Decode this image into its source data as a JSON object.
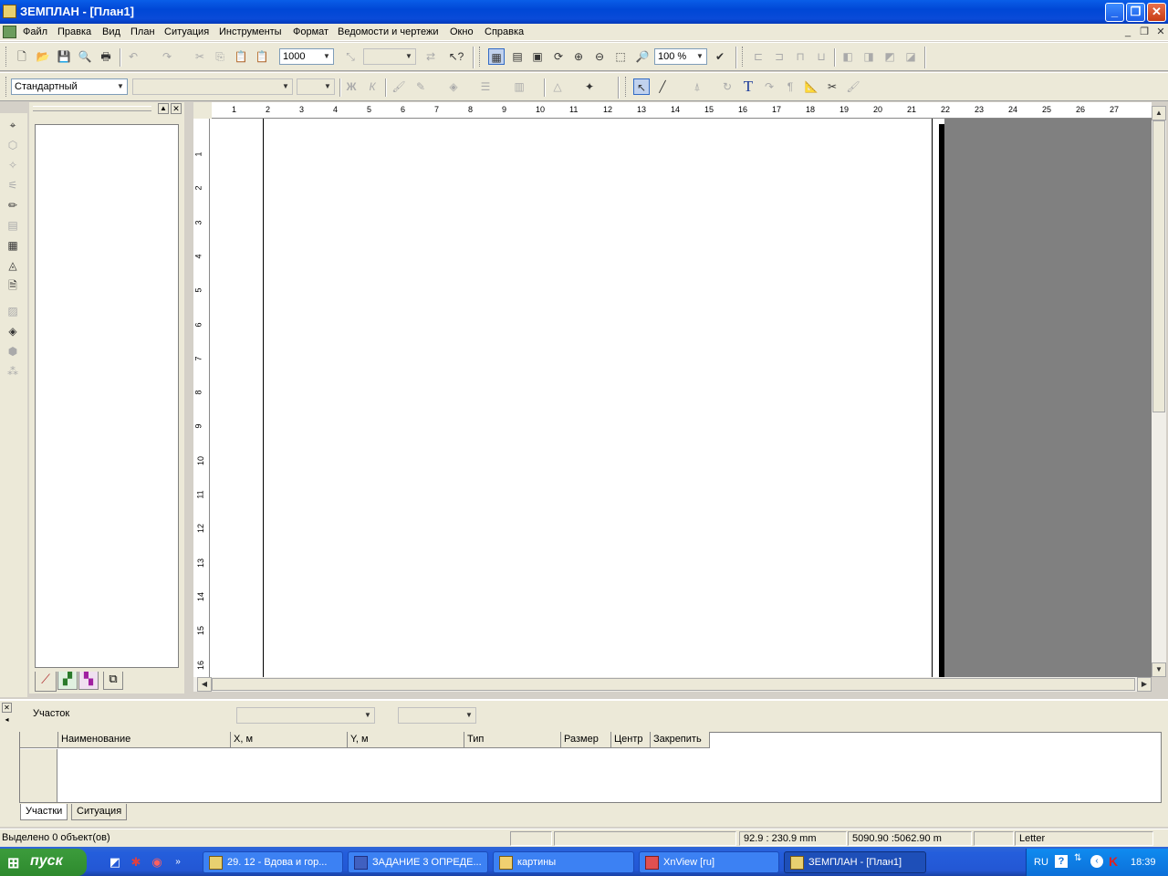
{
  "window": {
    "title": "ЗЕМПЛАН - [План1]"
  },
  "menu": [
    "Файл",
    "Правка",
    "Вид",
    "План",
    "Ситуация",
    "Инструменты",
    "Формат",
    "Ведомости и чертежи",
    "Окно",
    "Справка"
  ],
  "toolbar1": {
    "scale_value": "1000",
    "zoom_value": "100 %"
  },
  "toolbar2": {
    "style_value": "Стандартный",
    "bold_label": "Ж",
    "italic_label": "К",
    "text_tool": "T"
  },
  "ruler_top": [
    "1",
    "2",
    "3",
    "4",
    "5",
    "6",
    "7",
    "8",
    "9",
    "10",
    "11",
    "12",
    "13",
    "14",
    "15",
    "16",
    "17",
    "18",
    "19",
    "20",
    "21",
    "22",
    "23",
    "24",
    "25",
    "26",
    "27"
  ],
  "ruler_left": [
    "1",
    "2",
    "3",
    "4",
    "5",
    "6",
    "7",
    "8",
    "9",
    "10",
    "11",
    "12",
    "13",
    "14",
    "15",
    "16"
  ],
  "bottom_panel": {
    "section_label": "Участок",
    "columns": [
      "Наименование",
      "X, м",
      "Y, м",
      "Тип",
      "Размер",
      "Центр",
      "Закрепить"
    ],
    "tabs": [
      "Участки",
      "Ситуация"
    ]
  },
  "status": {
    "selected": "Выделено 0 объект(ов)",
    "cursor_mm": "92.9 : 230.9 mm",
    "cursor_m": "5090.90 :5062.90 m",
    "paper": "Letter"
  },
  "taskbar": {
    "start_label": "пуск",
    "tasks": [
      "29. 12 - Вдова и гор...",
      "ЗАДАНИЕ 3 ОПРЕДЕ...",
      "картины",
      "XnView [ru]",
      "ЗЕМПЛАН - [План1]"
    ],
    "language": "RU",
    "time": "18:39"
  }
}
